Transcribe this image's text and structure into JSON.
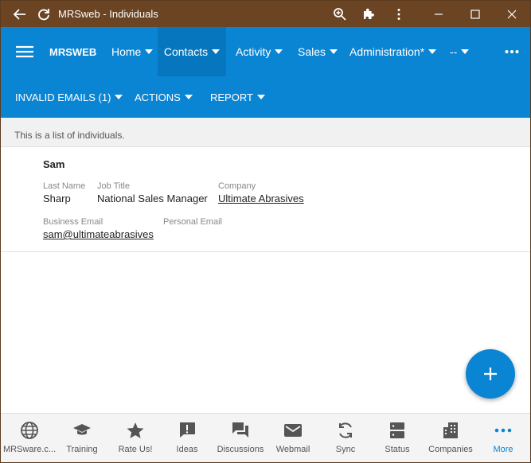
{
  "window": {
    "title": "MRSweb - Individuals"
  },
  "mainnav": {
    "brand": "MRSWEB",
    "items": [
      {
        "label": "Home"
      },
      {
        "label": "Contacts"
      },
      {
        "label": "Activity"
      },
      {
        "label": "Sales"
      },
      {
        "label": "Administration*"
      },
      {
        "label": "--"
      }
    ]
  },
  "subnav": {
    "items": [
      {
        "label": "INVALID EMAILS (1)"
      },
      {
        "label": "ACTIONS"
      },
      {
        "label": "REPORT"
      }
    ]
  },
  "info": {
    "text": "This is a list of individuals."
  },
  "record": {
    "first_name": "Sam",
    "last_name_label": "Last Name",
    "last_name": "Sharp",
    "job_title_label": "Job Title",
    "job_title": "National Sales Manager",
    "company_label": "Company",
    "company": "Ultimate Abrasives",
    "business_email_label": "Business Email",
    "business_email": "sam@ultimateabrasives",
    "personal_email_label": "Personal Email",
    "personal_email": ""
  },
  "bottombar": {
    "items": [
      {
        "label": "MRSware.c...",
        "icon": "globe-icon"
      },
      {
        "label": "Training",
        "icon": "graduation-cap-icon"
      },
      {
        "label": "Rate Us!",
        "icon": "star-icon"
      },
      {
        "label": "Ideas",
        "icon": "idea-icon"
      },
      {
        "label": "Discussions",
        "icon": "discussions-icon"
      },
      {
        "label": "Webmail",
        "icon": "mail-icon"
      },
      {
        "label": "Sync",
        "icon": "sync-icon"
      },
      {
        "label": "Status",
        "icon": "status-icon"
      },
      {
        "label": "Companies",
        "icon": "building-icon"
      },
      {
        "label": "More",
        "icon": "more-icon"
      }
    ]
  },
  "colors": {
    "titlebar": "#6b4423",
    "accent": "#0a85d4",
    "active_nav": "#0676be"
  }
}
